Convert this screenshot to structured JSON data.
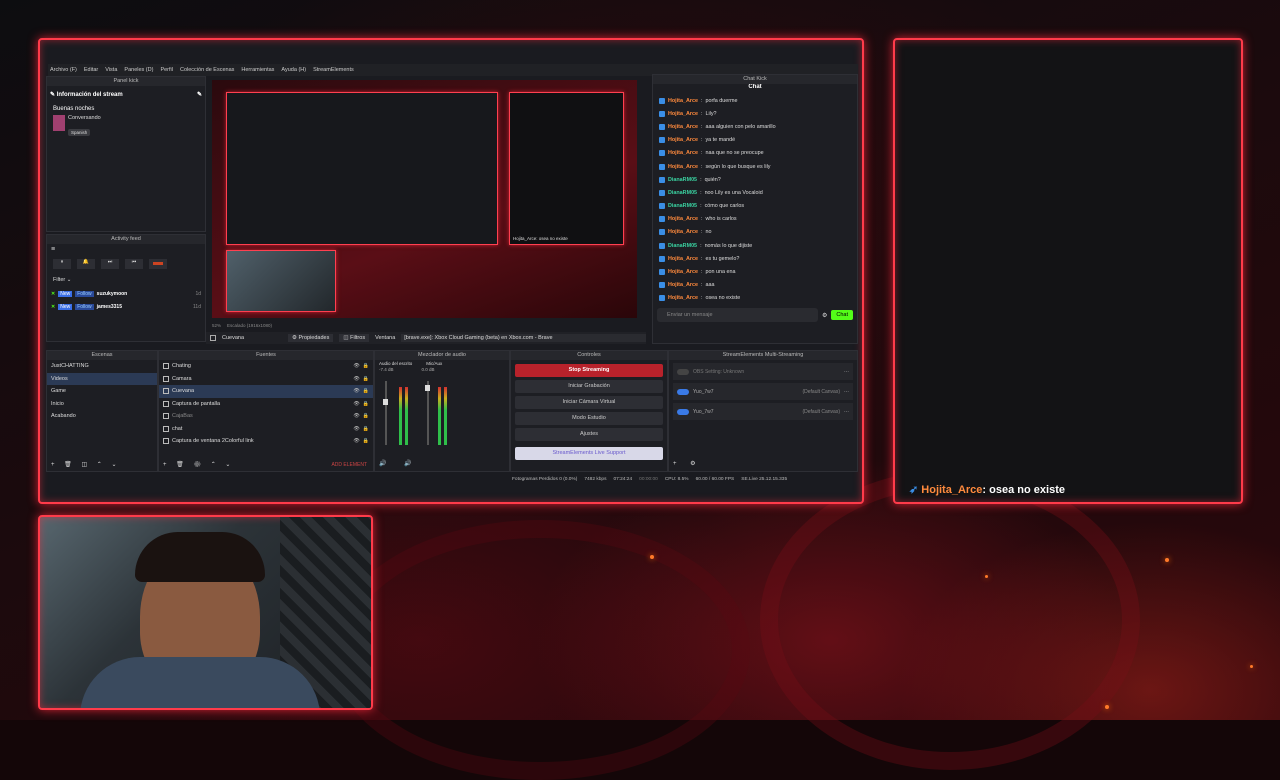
{
  "menu": [
    "Archivo (F)",
    "Editar",
    "Vista",
    "Paneles (D)",
    "Perfil",
    "Colección de Escenas",
    "Herramientas",
    "Ayuda (H)",
    "StreamElements"
  ],
  "panel_kick": {
    "title": "Panel kick",
    "info_label": "Información del stream",
    "stream_title": "Buenas noches",
    "category": "Conversando",
    "language": "Spanish"
  },
  "activity": {
    "title": "Activity feed",
    "filter_label": "Filter",
    "items": [
      {
        "badge": "New",
        "action": "Follow",
        "user": "suzukymoon",
        "time": "1d"
      },
      {
        "badge": "New",
        "action": "Follow",
        "user": "james3315",
        "time": "11d"
      }
    ]
  },
  "preview_bar": {
    "zoom": "52%",
    "scaled": "Escalado (1916x1080)",
    "source_name": "Cuevana",
    "props_label": "Propiedades",
    "filters_label": "Filtros",
    "window_label": "Ventana",
    "window_value": "[brave.exe]: Xbox Cloud Gaming (beta) en Xbox.com - Brave"
  },
  "preview_overlay_chat": "Hojita_Arce: osea no existe",
  "chat_kick": {
    "title": "Chat Kick",
    "tab": "Chat",
    "placeholder": "Enviar un mensaje",
    "send": "Chat",
    "messages": [
      {
        "user": "Hojita_Arce",
        "text": "porfa duerme",
        "c": "u1"
      },
      {
        "user": "Hojita_Arce",
        "text": "Lily?",
        "c": "u1"
      },
      {
        "user": "Hojita_Arce",
        "text": "aaa alguien con pelo amarillo",
        "c": "u1"
      },
      {
        "user": "Hojita_Arce",
        "text": "ya te mandé",
        "c": "u1"
      },
      {
        "user": "Hojita_Arce",
        "text": "naa que no se preocupe",
        "c": "u1"
      },
      {
        "user": "Hojita_Arce",
        "text": "según lo que busque es lily",
        "c": "u1"
      },
      {
        "user": "DianaRM05",
        "text": "quién?",
        "c": "u2"
      },
      {
        "user": "DianaRM05",
        "text": "noo Lily es una Vocaloid",
        "c": "u2"
      },
      {
        "user": "DianaRM05",
        "text": "cómo que carlos",
        "c": "u2"
      },
      {
        "user": "Hojita_Arce",
        "text": "who is carlos",
        "c": "u1"
      },
      {
        "user": "Hojita_Arce",
        "text": "no",
        "c": "u1"
      },
      {
        "user": "DianaRM05",
        "text": "nomás lo que dijiste",
        "c": "u2"
      },
      {
        "user": "Hojita_Arce",
        "text": "es tu gemelo?",
        "c": "u1"
      },
      {
        "user": "Hojita_Arce",
        "text": "pon una ena",
        "c": "u1"
      },
      {
        "user": "Hojita_Arce",
        "text": "aaa",
        "c": "u1"
      },
      {
        "user": "Hojita_Arce",
        "text": "osea no existe",
        "c": "u1"
      }
    ]
  },
  "scenes": {
    "title": "Escenas",
    "items": [
      "JustCHATTING",
      "Videos",
      "Game",
      "Inicio",
      "Acabando"
    ],
    "selected": 1
  },
  "sources": {
    "title": "Fuentes",
    "items": [
      "Chating",
      "Camara",
      "Cuevana",
      "Captura de pantalla",
      "CajaBas",
      "chat",
      "Captura de ventana 2Colorful link"
    ],
    "selected": 2,
    "add": "ADD ELEMENT"
  },
  "mixer": {
    "title": "Mezclador de audio",
    "ch1": "Audio del escrito",
    "ch1_db": "-7.4 dB",
    "ch2": "Mic/Aux",
    "ch2_db": "0.0 dB"
  },
  "controls": {
    "title": "Controles",
    "stop": "Stop Streaming",
    "record": "Iniciar Grabación",
    "vcam": "Iniciar Cámara Virtual",
    "studio": "Modo Estudio",
    "settings": "Ajustes",
    "se": "StreamElements Live Support"
  },
  "multi": {
    "title": "StreamElements Multi-Streaming",
    "items": [
      {
        "name": "OBS Setting: Unknown",
        "sub": ""
      },
      {
        "name": "Yuo_7w7",
        "sub": "(Default Canvas)"
      },
      {
        "name": "Yuo_7w7",
        "sub": "(Default Canvas)"
      }
    ]
  },
  "status": {
    "frames": "Fotogramas Perdidos 0 (0.0%)",
    "kbps": "7482 kbps",
    "live": "07:24:24",
    "rec": "00:00:00",
    "cpu": "CPU: 8.5%",
    "fps": "60.00 / 60.00 FPS",
    "version": "SE.Live 25.12.15.335"
  },
  "overlay": {
    "chat_user": "Hojita_Arce",
    "chat_text": "osea no existe"
  },
  "colors": {
    "accent": "#ff3b4a",
    "stop": "#b8222b",
    "kick": "#53fc18"
  }
}
